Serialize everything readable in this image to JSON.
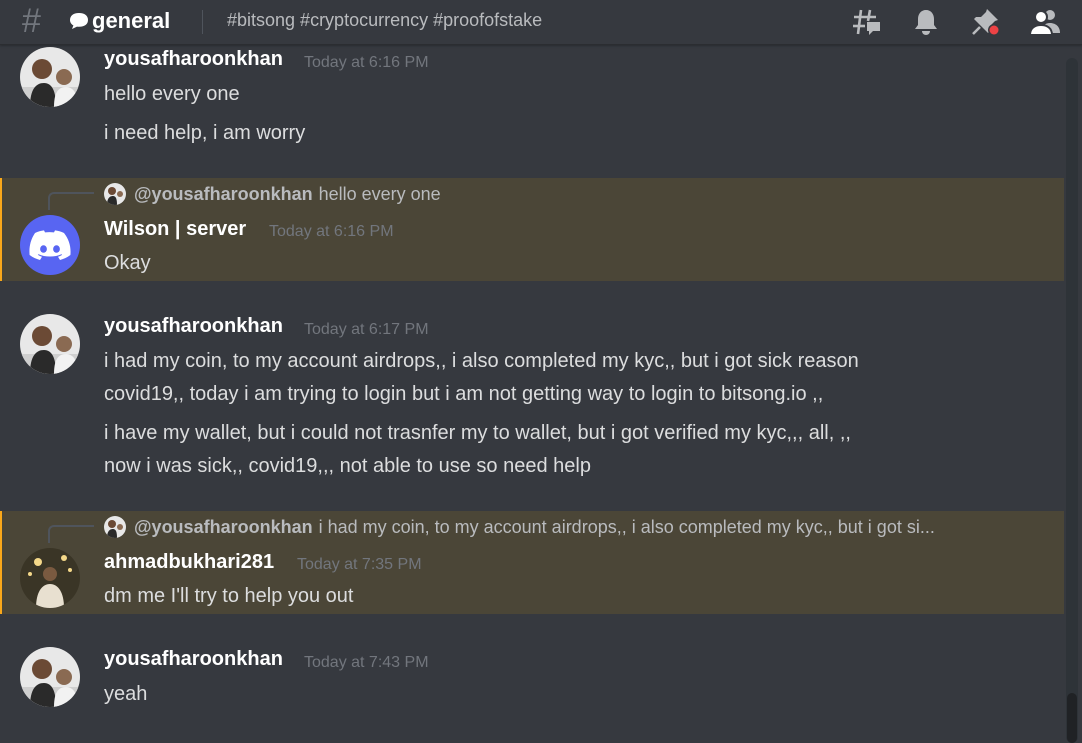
{
  "header": {
    "channel_name": "general",
    "topic": "#bitsong #cryptocurrency #proofofstake",
    "icons": [
      "threads-icon",
      "bell-icon",
      "pin-icon",
      "members-icon"
    ],
    "pin_badge_color": "#ed4245"
  },
  "messages": [
    {
      "username": "yousafharoonkhan",
      "timestamp": "Today at 6:16 PM",
      "lines": [
        "hello every one",
        "i need help, i am worry"
      ]
    },
    {
      "reply": {
        "user": "@yousafharoonkhan",
        "text": "hello every one"
      },
      "username": "Wilson | server",
      "timestamp": "Today at 6:16 PM",
      "lines": [
        "Okay"
      ],
      "highlighted": true,
      "avatar_color": "#5865f2"
    },
    {
      "username": "yousafharoonkhan",
      "timestamp": "Today at 6:17 PM",
      "lines": [
        "i had my coin, to my account airdrops,, i also completed my kyc,, but i got sick reason",
        "covid19,, today i am trying to login but i am not getting way to login to bitsong.io ,,",
        "i have my wallet, but i could not trasnfer my to wallet, but i got verified my kyc,,, all, ,,",
        "now i was sick,, covid19,,, not able to use so need help"
      ]
    },
    {
      "reply": {
        "user": "@yousafharoonkhan",
        "text": "i had my coin, to my account airdrops,, i also completed my kyc,, but i got si..."
      },
      "username": "ahmadbukhari281",
      "timestamp": "Today at 7:35 PM",
      "lines": [
        "dm me I'll try to help you out"
      ],
      "highlighted": true
    },
    {
      "username": "yousafharoonkhan",
      "timestamp": "Today at 7:43 PM",
      "lines": [
        "yeah"
      ]
    }
  ],
  "colors": {
    "background": "#36393f",
    "highlight": "#4b4637",
    "highlight_border": "#faa81a"
  }
}
